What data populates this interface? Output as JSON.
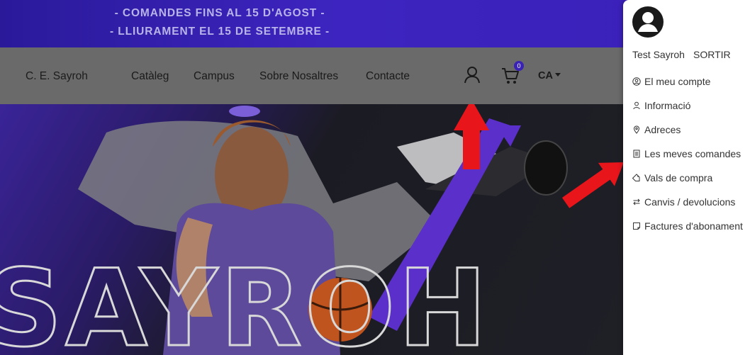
{
  "banner": {
    "line1": "- COMANDES FINS AL 15 D'AGOST -",
    "line2": "- LLIURAMENT EL 15 DE SETEMBRE -"
  },
  "header": {
    "brand": "C. E. Sayroh",
    "nav": [
      "Catàleg",
      "Campus",
      "Sobre Nosaltres",
      "Contacte"
    ],
    "user_icon": "user-icon",
    "cart_icon": "cart-icon",
    "cart_count": "0",
    "language": "CA"
  },
  "hero": {
    "title": "SAYROH"
  },
  "account_menu": {
    "user_name": "Test Sayroh",
    "logout_label": "SORTIR",
    "items": [
      {
        "label": "El meu compte",
        "icon": "account-circle-icon"
      },
      {
        "label": "Informació",
        "icon": "user-icon"
      },
      {
        "label": "Adreces",
        "icon": "location-pin-icon"
      },
      {
        "label": "Les meves comandes",
        "icon": "orders-icon"
      },
      {
        "label": "Vals de compra",
        "icon": "tag-icon"
      },
      {
        "label": "Canvis / devolucions",
        "icon": "exchange-icon"
      },
      {
        "label": "Factures d'abonament",
        "icon": "note-icon"
      }
    ]
  },
  "colors": {
    "banner": "#3d24c0",
    "header_overlay": "#6a6a6a",
    "accent": "#6a3fd6",
    "annotation_arrow": "#e8151b"
  }
}
